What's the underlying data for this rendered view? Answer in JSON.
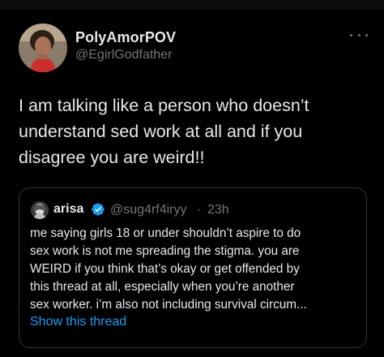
{
  "tweet": {
    "author_name": "PolyAmorPOV",
    "author_handle": "@EgirlGodfather",
    "more_icon": "more-horizontal-icon",
    "text": "I am talking like a person who doesn’t\nunderstand sed work at all and if you\ndisagree you are weird!!"
  },
  "quote": {
    "author_name": "arisa",
    "verified_icon": "verified-badge-icon",
    "author_handle": "@sug4rf4iryy",
    "separator": "·",
    "time": "23h",
    "text": "me saying girls 18 or under shouldn’t aspire to do\nsex work is not me spreading the stigma. you are\nWEIRD if you think that’s okay or get offended by\nthis thread at all, especially when you’re another\nsex worker. i’m also not including survival circum...",
    "show_thread_label": "Show this thread"
  },
  "colors": {
    "background": "#000000",
    "text": "#e7e9ea",
    "secondary": "#71767b",
    "link": "#1d9bf0",
    "verified": "#1d9bf0",
    "border": "#333639"
  }
}
